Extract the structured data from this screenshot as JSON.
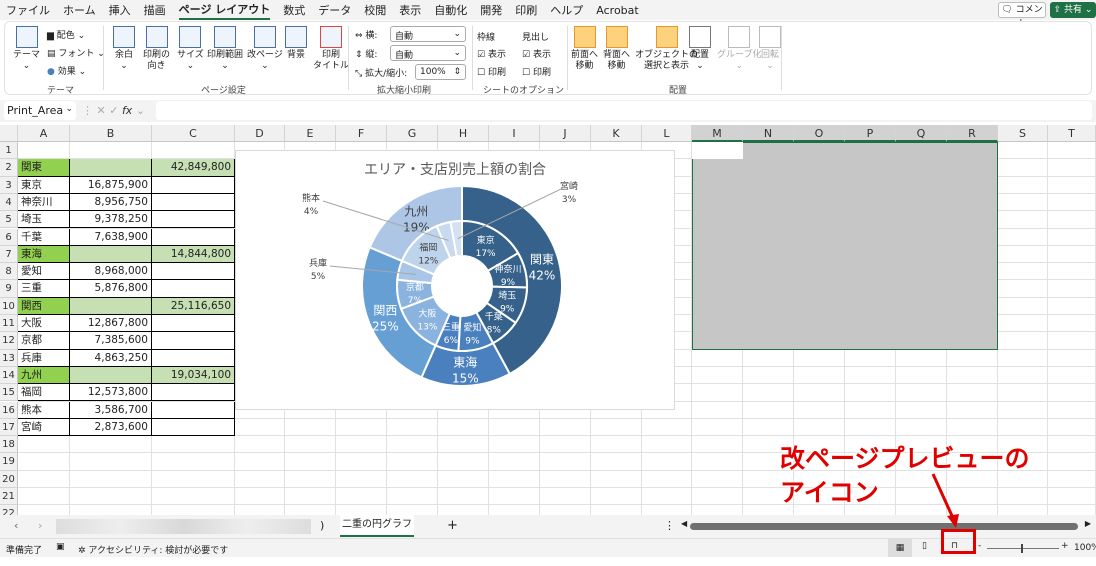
{
  "menu": [
    "ファイル",
    "ホーム",
    "挿入",
    "描画",
    "ページ レイアウト",
    "数式",
    "データ",
    "校閲",
    "表示",
    "自動化",
    "開発",
    "印刷",
    "ヘルプ",
    "Acrobat"
  ],
  "comment_label": "コメント",
  "share_label": "共有",
  "ribbon": {
    "theme": {
      "theme": "テーマ",
      "colors": "配色",
      "fonts": "フォント",
      "effects": "効果",
      "group": "テーマ"
    },
    "page_setup": {
      "margins": "余白",
      "orientation": "印刷の\n向き",
      "size": "サイズ",
      "print_area": "印刷範囲",
      "breaks": "改ページ",
      "background": "背景",
      "print_titles": "印刷\nタイトル",
      "group": "ページ設定"
    },
    "scale": {
      "width_label": "横:",
      "width_value": "自動",
      "height_label": "縦:",
      "height_value": "自動",
      "scale_label": "拡大/縮小:",
      "scale_value": "100%",
      "group": "拡大縮小印刷"
    },
    "sheet_options": {
      "gridlines": "枠線",
      "headings": "見出し",
      "view": "表示",
      "print": "印刷",
      "group": "シートのオプション"
    },
    "arrange": {
      "bring_forward": "前面へ\n移動",
      "send_backward": "背面へ\n移動",
      "selection_pane": "オブジェクトの\n選択と表示",
      "align": "配置",
      "group_btn": "グループ化",
      "rotate": "回転",
      "group": "配置"
    }
  },
  "formula_bar": {
    "name_box": "Print_Area",
    "fx": "fx",
    "value": ""
  },
  "columns": [
    "A",
    "B",
    "C",
    "D",
    "E",
    "F",
    "G",
    "H",
    "I",
    "J",
    "K",
    "L",
    "M",
    "N",
    "O",
    "P",
    "Q",
    "R",
    "S",
    "T"
  ],
  "rows": [
    "1",
    "2",
    "3",
    "4",
    "5",
    "6",
    "7",
    "8",
    "9",
    "10",
    "11",
    "12",
    "13",
    "14",
    "15",
    "16",
    "17",
    "18",
    "19",
    "20",
    "21",
    "22"
  ],
  "table": [
    {
      "a": "関東",
      "b": "",
      "c": "42,849,800",
      "area": true
    },
    {
      "a": "東京",
      "b": "16,875,900",
      "c": ""
    },
    {
      "a": "神奈川",
      "b": "8,956,750",
      "c": ""
    },
    {
      "a": "埼玉",
      "b": "9,378,250",
      "c": ""
    },
    {
      "a": "千葉",
      "b": "7,638,900",
      "c": ""
    },
    {
      "a": "東海",
      "b": "",
      "c": "14,844,800",
      "area": true
    },
    {
      "a": "愛知",
      "b": "8,968,000",
      "c": ""
    },
    {
      "a": "三重",
      "b": "5,876,800",
      "c": ""
    },
    {
      "a": "関西",
      "b": "",
      "c": "25,116,650",
      "area": true
    },
    {
      "a": "大阪",
      "b": "12,867,800",
      "c": ""
    },
    {
      "a": "京都",
      "b": "7,385,600",
      "c": ""
    },
    {
      "a": "兵庫",
      "b": "4,863,250",
      "c": ""
    },
    {
      "a": "九州",
      "b": "",
      "c": "19,034,100",
      "area": true
    },
    {
      "a": "福岡",
      "b": "12,573,800",
      "c": ""
    },
    {
      "a": "熊本",
      "b": "3,586,700",
      "c": ""
    },
    {
      "a": "宮崎",
      "b": "2,873,600",
      "c": ""
    }
  ],
  "chart_data": {
    "type": "doughnut",
    "title": "エリア・支店別売上額の割合",
    "outer": [
      {
        "name": "関東",
        "value": 42849800,
        "pct": "42%",
        "color": "#36618a"
      },
      {
        "name": "東海",
        "value": 14844800,
        "pct": "15%",
        "color": "#4a80bd"
      },
      {
        "name": "関西",
        "value": 25116650,
        "pct": "25%",
        "color": "#659fd4"
      },
      {
        "name": "九州",
        "value": 19034100,
        "pct": "19%",
        "color": "#aec6e6"
      }
    ],
    "inner": [
      {
        "name": "東京",
        "value": 16875900,
        "pct": "17%",
        "color": "#36618a"
      },
      {
        "name": "神奈川",
        "value": 8956750,
        "pct": "9%",
        "color": "#36618a"
      },
      {
        "name": "埼玉",
        "value": 9378250,
        "pct": "9%",
        "color": "#36618a"
      },
      {
        "name": "千葉",
        "value": 7638900,
        "pct": "8%",
        "color": "#36618a"
      },
      {
        "name": "愛知",
        "value": 8968000,
        "pct": "9%",
        "color": "#4a80bd"
      },
      {
        "name": "三重",
        "value": 5876800,
        "pct": "6%",
        "color": "#4a80bd"
      },
      {
        "name": "大阪",
        "value": 12867800,
        "pct": "13%",
        "color": "#8ab3e0"
      },
      {
        "name": "京都",
        "value": 7385600,
        "pct": "7%",
        "color": "#8ab3e0"
      },
      {
        "name": "兵庫",
        "value": 4863250,
        "pct": "5%",
        "color": "#a9c6e8"
      },
      {
        "name": "福岡",
        "value": 12573800,
        "pct": "12%",
        "color": "#bed3ec"
      },
      {
        "name": "熊本",
        "value": 3586700,
        "pct": "4%",
        "color": "#c9daef"
      },
      {
        "name": "宮崎",
        "value": 2873600,
        "pct": "3%",
        "color": "#d3e1f2"
      }
    ]
  },
  "sheet_tabs": {
    "active": "二重の円グラフ",
    "hidden_tab_suffix": ")",
    "add": "+"
  },
  "status": {
    "ready": "準備完了",
    "accessibility": "アクセシビリティ: 検討が必要です",
    "zoom": "100%"
  },
  "annotation": {
    "line1": "改ページプレビューの",
    "line2": "アイコン",
    "color": "#e00000"
  }
}
